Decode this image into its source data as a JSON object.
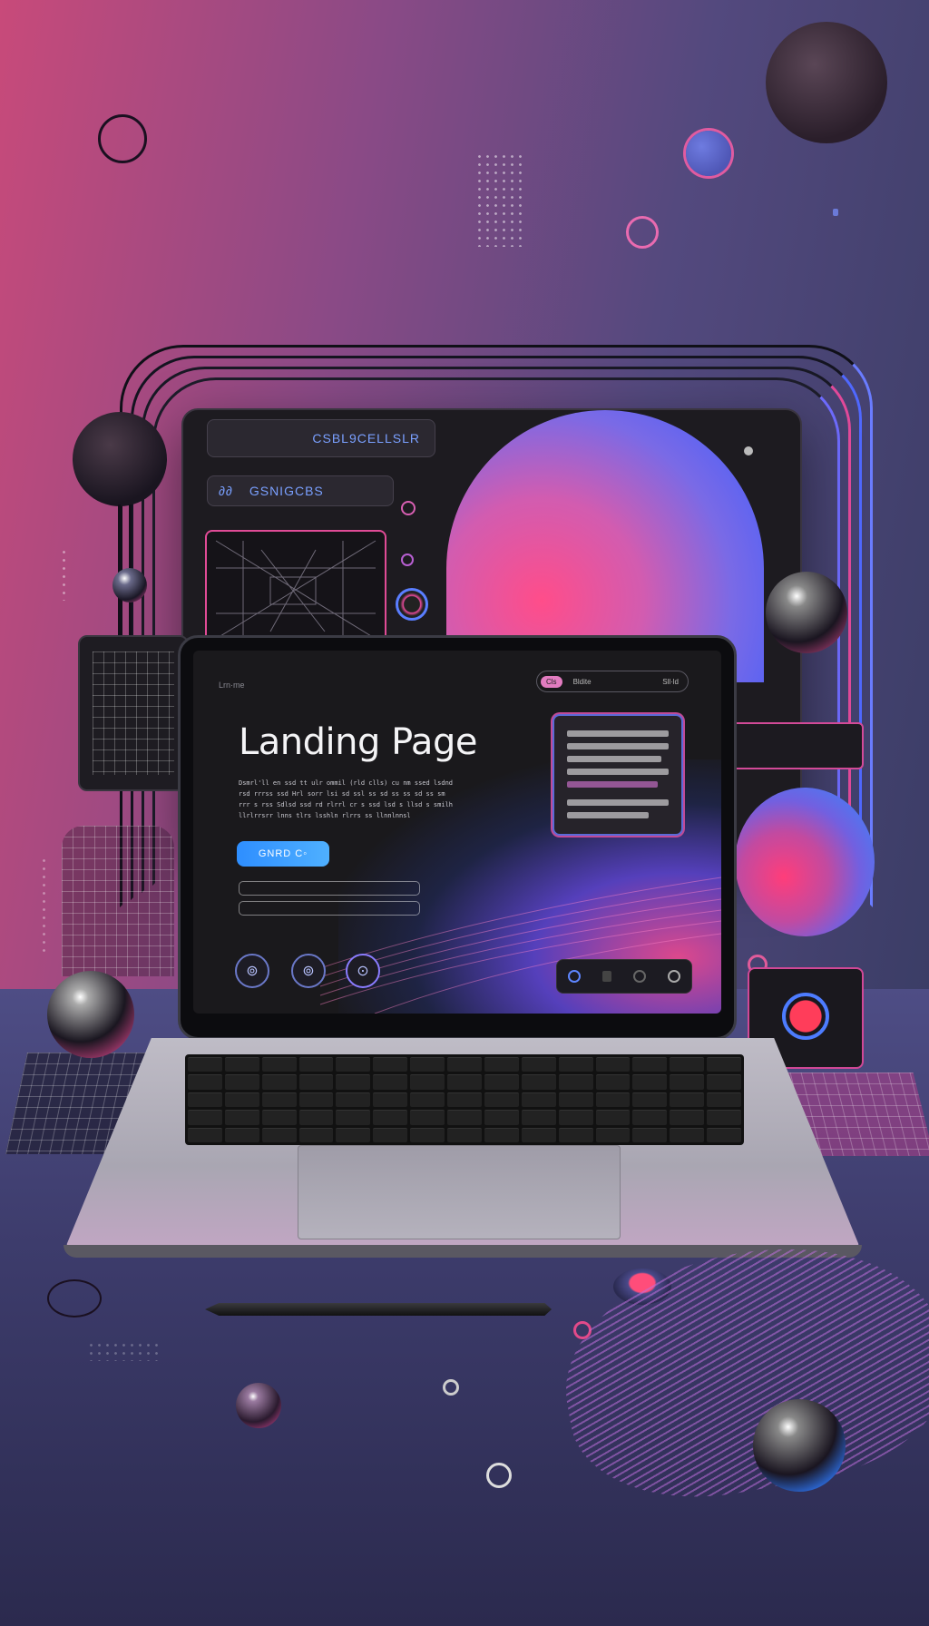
{
  "screen": {
    "nav_brand": "Lrn·me",
    "nav_items": [
      "Cls",
      "Bldite",
      "Sll·ld"
    ],
    "hero_title": "Landing Page",
    "body_lines": [
      "Dsmrl'll en ssd tt ulr ommil (rld clls) cu nm ssed lsdnd",
      "rsd rrrss ssd Hrl sorr lsi sd ssl ss sd ss ss sd ss sm",
      "rrr s rss Sdlsd ssd rd rlrrl cr s ssd lsd s llsd s smilh",
      "llrlrrsrr lnns tlrs lsshln rlrrs ss llnnlnnsl"
    ],
    "cta_label": "GNRD C◦"
  },
  "back_panel": {
    "top_pill": "CSBL9CELLSLR",
    "mid_pill_prefix": "∂∂",
    "mid_pill": "GSNIGCBS"
  },
  "colors": {
    "accent_blue": "#3a8cff",
    "accent_pink": "#ff3d9a",
    "panel_dark": "#1d1b20"
  }
}
